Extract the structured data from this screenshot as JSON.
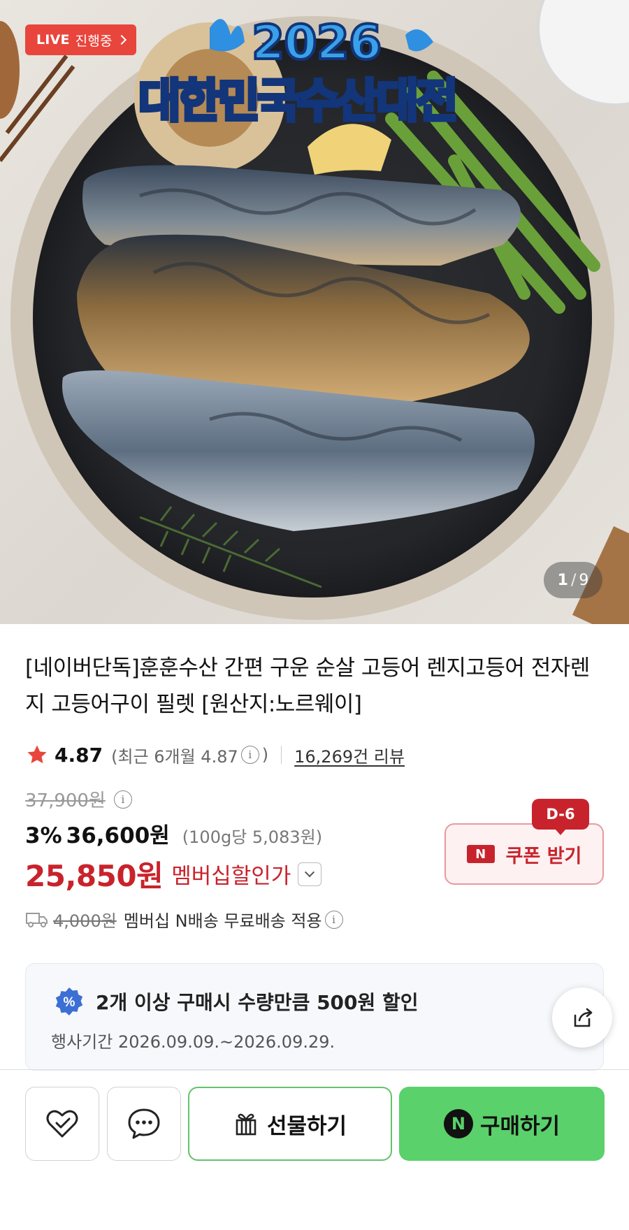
{
  "hero": {
    "live_badge": {
      "word": "LIVE",
      "state": "진행중"
    },
    "event": {
      "year": "2026",
      "title": "대한민국수산대전"
    },
    "counter": {
      "current": "1",
      "separator": "/",
      "total": "9"
    }
  },
  "product": {
    "title": "[네이버단독]훈훈수산 간편 구운 순살 고등어 렌지고등어 전자렌지 고등어구이 필렛 [원산지:노르웨이]",
    "rating": {
      "value": "4.87",
      "recent_open": "(최근 6개월 4.87",
      "recent_close": ")",
      "review_count": "16,269건 리뷰",
      "star_color": "#e8453c"
    },
    "price": {
      "original": "37,900원",
      "discount_pct": "3%",
      "sale": "36,600원",
      "unit": "(100g당 5,083원)",
      "member_price": "25,850원",
      "member_label": "멤버십할인가"
    },
    "coupon": {
      "dday": "D-6",
      "logo": "N",
      "label": "쿠폰 받기"
    },
    "shipping": {
      "old_fee": "4,000원",
      "note": "멤버십 N배송 무료배송 적용"
    },
    "promo": {
      "badge": "%",
      "title": "2개 이상 구매시 수량만큼 500원 할인",
      "period": "행사기간 2026.09.09.~2026.09.29."
    }
  },
  "bottom_bar": {
    "wishlist_icon": "heart-check-icon",
    "chat_icon": "chat-bubble-icon",
    "gift_label": "선물하기",
    "buy_logo": "N",
    "buy_label": "구매하기"
  },
  "colors": {
    "accent_red": "#c8232c",
    "buy_green": "#5ad16b",
    "gift_border": "#63c36a"
  }
}
